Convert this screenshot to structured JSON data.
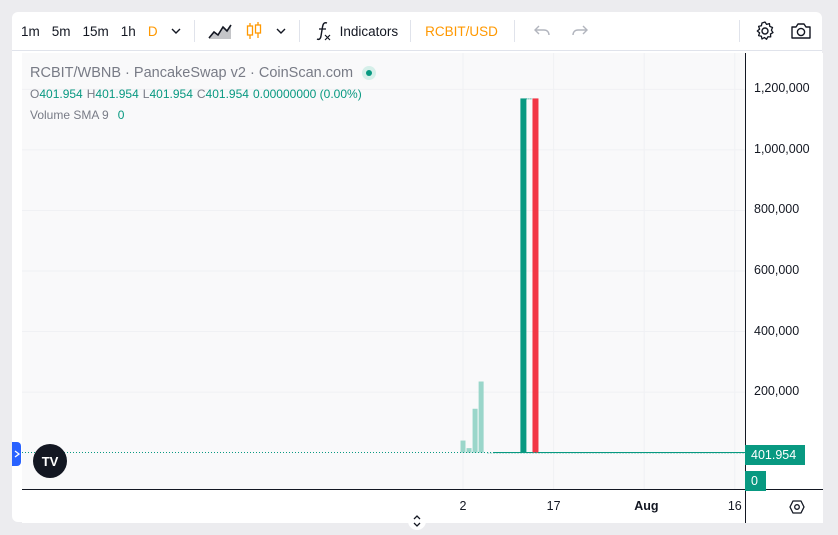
{
  "toolbar": {
    "intervals": [
      {
        "label": "1m",
        "active": false
      },
      {
        "label": "5m",
        "active": false
      },
      {
        "label": "15m",
        "active": false
      },
      {
        "label": "1h",
        "active": false
      },
      {
        "label": "D",
        "active": true
      }
    ],
    "indicators_label": "Indicators",
    "symbol_label": "RCBIT/USD",
    "icons": [
      "chevron-down-icon",
      "line-chart-icon",
      "candles-icon",
      "function-icon",
      "undo-icon",
      "redo-icon",
      "gear-icon",
      "camera-icon"
    ]
  },
  "legend": {
    "title": "RCBIT/WBNB · PancakeSwap v2 · CoinScan.com",
    "ohlc": [
      {
        "key": "O",
        "value": "401.954"
      },
      {
        "key": "H",
        "value": "401.954"
      },
      {
        "key": "L",
        "value": "401.954"
      },
      {
        "key": "C",
        "value": "401.954"
      }
    ],
    "change": "0.00000000 (0.00%)",
    "volume_label": "Volume SMA 9",
    "volume_value": "0"
  },
  "chart_data": {
    "type": "candlestick",
    "title": "RCBIT/WBNB · PancakeSwap v2 · CoinScan.com",
    "y_ticks": [
      200000,
      400000,
      600000,
      800000,
      1000000,
      1200000
    ],
    "y_tick_labels": [
      "200,000",
      "400,000",
      "600,000",
      "800,000",
      "1,000,000",
      "1,200,000"
    ],
    "ylim": [
      -120000,
      1320000
    ],
    "x_tick_labels": [
      "2",
      "17",
      "Aug",
      "16"
    ],
    "last_price": 401.954,
    "last_price_label": "401.954",
    "last_volume_label": "0",
    "candles": [
      {
        "date": "Jul 12",
        "open": 401.954,
        "close": 1170000,
        "high": 1170000,
        "low": 401.954
      },
      {
        "date": "Jul 14",
        "open": 1170000,
        "close": 401.954,
        "high": 1170000,
        "low": 401.954
      }
    ],
    "volume": [
      {
        "date": "Jul 2",
        "value": 40000
      },
      {
        "date": "Jul 3",
        "value": 15000
      },
      {
        "date": "Jul 4",
        "value": 145000
      },
      {
        "date": "Jul 5",
        "value": 235000
      }
    ],
    "colors": {
      "up": "#089981",
      "down": "#f23645",
      "volume": "#9ad6ca",
      "grid": "#f0f1f4"
    }
  }
}
